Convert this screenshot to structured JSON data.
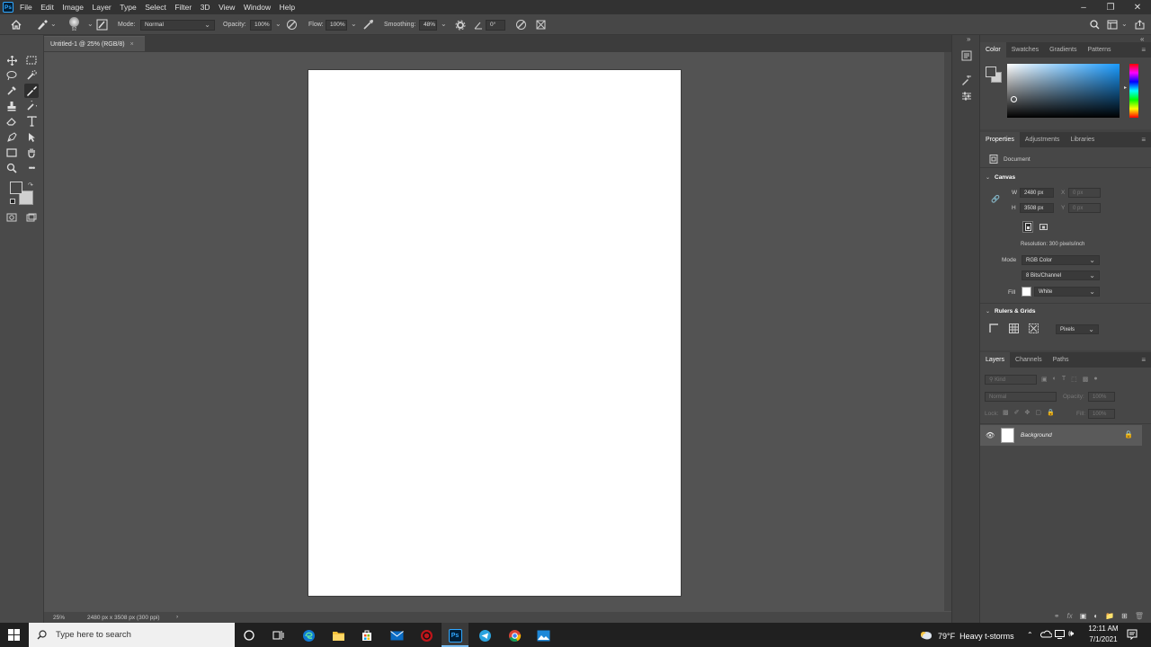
{
  "menubar": {
    "logo": "Ps",
    "items": [
      "File",
      "Edit",
      "Image",
      "Layer",
      "Type",
      "Select",
      "Filter",
      "3D",
      "View",
      "Window",
      "Help"
    ]
  },
  "options": {
    "brush_size": "92",
    "mode_label": "Mode:",
    "mode_value": "Normal",
    "opacity_label": "Opacity:",
    "opacity_value": "100%",
    "flow_label": "Flow:",
    "flow_value": "100%",
    "smoothing_label": "Smoothing:",
    "smoothing_value": "48%",
    "angle_value": "0°"
  },
  "doc_tab": {
    "title": "Untitled-1 @ 25% (RGB/8)",
    "close": "×"
  },
  "status": {
    "zoom": "25%",
    "info": "2480 px x 3508 px (300 ppi)",
    "arrow": "›"
  },
  "color_panel": {
    "tabs": [
      "Color",
      "Swatches",
      "Gradients",
      "Patterns"
    ]
  },
  "properties_panel": {
    "tabs": [
      "Properties",
      "Adjustments",
      "Libraries"
    ],
    "document_label": "Document",
    "canvas_section": "Canvas",
    "w_label": "W",
    "w_value": "2480 px",
    "h_label": "H",
    "h_value": "3508 px",
    "x_label": "X",
    "x_value": "0 px",
    "y_label": "Y",
    "y_value": "0 px",
    "resolution": "Resolution: 300 pixels/inch",
    "mode_label": "Mode",
    "mode_value": "RGB Color",
    "bits_value": "8 Bits/Channel",
    "fill_label": "Fill",
    "fill_value": "White",
    "rulers_section": "Rulers & Grids",
    "units_value": "Pixels"
  },
  "layers_panel": {
    "tabs": [
      "Layers",
      "Channels",
      "Paths"
    ],
    "kind_placeholder": "Kind",
    "blend_value": "Normal",
    "opacity_label": "Opacity:",
    "opacity_value": "100%",
    "lock_label": "Lock:",
    "fill_label": "Fill:",
    "fill_value": "100%",
    "layer_name": "Background"
  },
  "taskbar": {
    "search_placeholder": "Type here to search",
    "weather": "79°F  Heavy t-storms",
    "time": "12:11 AM",
    "date": "7/1/2021"
  },
  "colors": {
    "ui_dark": "#323232",
    "panel": "#474747",
    "canvas_bg": "#535353",
    "document": "#ffffff",
    "accent_blue": "#31a8ff"
  }
}
